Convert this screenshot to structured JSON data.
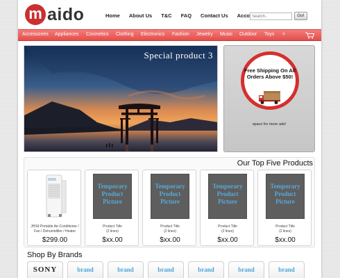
{
  "logo": {
    "mark": "m",
    "text": "aido"
  },
  "topnav": [
    "Home",
    "About Us",
    "T&C",
    "FAQ",
    "Contact Us",
    "Account"
  ],
  "search": {
    "placeholder": "Search..",
    "button_label": "Go!"
  },
  "categories": [
    "Accessories",
    "Appliances",
    "Cosmetics",
    "Clothing",
    "Electronics",
    "Fashion",
    "Jewelry",
    "Music",
    "Outdoor",
    "Toys",
    ">"
  ],
  "banner": {
    "caption": "Special product 3"
  },
  "ad": {
    "headline": "Free Shipping On All Orders Above $50!",
    "note": "space for more ads!"
  },
  "top_products": {
    "title": "Our Top Five Products",
    "items": [
      {
        "title": "JHS9 Portable Air-Conditioner / Fan / Dehumidifier / Heater",
        "price": "$299.00",
        "image": "air-conditioner-image"
      },
      {
        "title": "Product Title\n(2 lines)",
        "price": "$xx.00",
        "image": "Temporary Product Picture"
      },
      {
        "title": "Product Title\n(2 lines)",
        "price": "$xx.00",
        "image": "Temporary Product Picture"
      },
      {
        "title": "Product Title\n(2 lines)",
        "price": "$xx.00",
        "image": "Temporary Product Picture"
      },
      {
        "title": "Product Title\n(2 lines)",
        "price": "$xx.00",
        "image": "Temporary Product Picture"
      }
    ]
  },
  "brands": {
    "title": "Shop By Brands",
    "items": [
      "SONY",
      "brand",
      "brand",
      "brand",
      "brand",
      "brand",
      "brand"
    ]
  },
  "colors": {
    "accent_red": "#e24e4b",
    "temp_text_blue": "#58a9d9"
  }
}
